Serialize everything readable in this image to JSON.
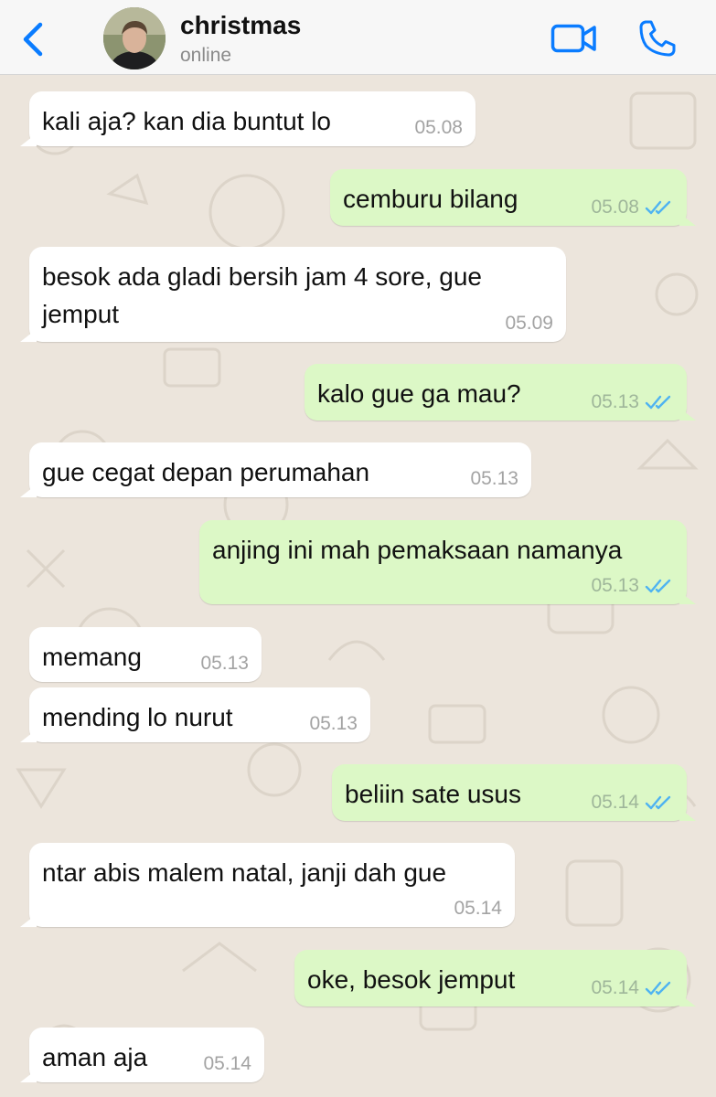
{
  "contact": {
    "name": "christmas",
    "status": "online"
  },
  "colors": {
    "accent": "#0a7cff",
    "outgoing": "#dcf8c6",
    "incoming": "#ffffff",
    "read_ticks": "#4fb3f1"
  },
  "icons": {
    "back": "chevron-left-icon",
    "video": "video-camera-icon",
    "call": "phone-icon",
    "read": "double-check-icon"
  },
  "messages": [
    {
      "dir": "in",
      "text": "kali aja? kan dia buntut lo",
      "time": "05.08"
    },
    {
      "dir": "out",
      "text": "cemburu bilang",
      "time": "05.08",
      "read": true
    },
    {
      "dir": "in",
      "text": "besok ada gladi bersih jam 4 sore, gue\njemput",
      "time": "05.09"
    },
    {
      "dir": "out",
      "text": "kalo gue ga mau?",
      "time": "05.13",
      "read": true
    },
    {
      "dir": "in",
      "text": "gue cegat depan perumahan",
      "time": "05.13"
    },
    {
      "dir": "out",
      "text": "anjing ini mah pemaksaan namanya",
      "time": "05.13",
      "read": true
    },
    {
      "dir": "in",
      "text": "memang",
      "time": "05.13"
    },
    {
      "dir": "in",
      "text": "mending lo nurut",
      "time": "05.13"
    },
    {
      "dir": "out",
      "text": "beliin sate usus",
      "time": "05.14",
      "read": true
    },
    {
      "dir": "in",
      "text": "ntar abis malem natal, janji dah gue",
      "time": "05.14"
    },
    {
      "dir": "out",
      "text": "oke, besok jemput",
      "time": "05.14",
      "read": true
    },
    {
      "dir": "in",
      "text": "aman aja",
      "time": "05.14"
    }
  ]
}
